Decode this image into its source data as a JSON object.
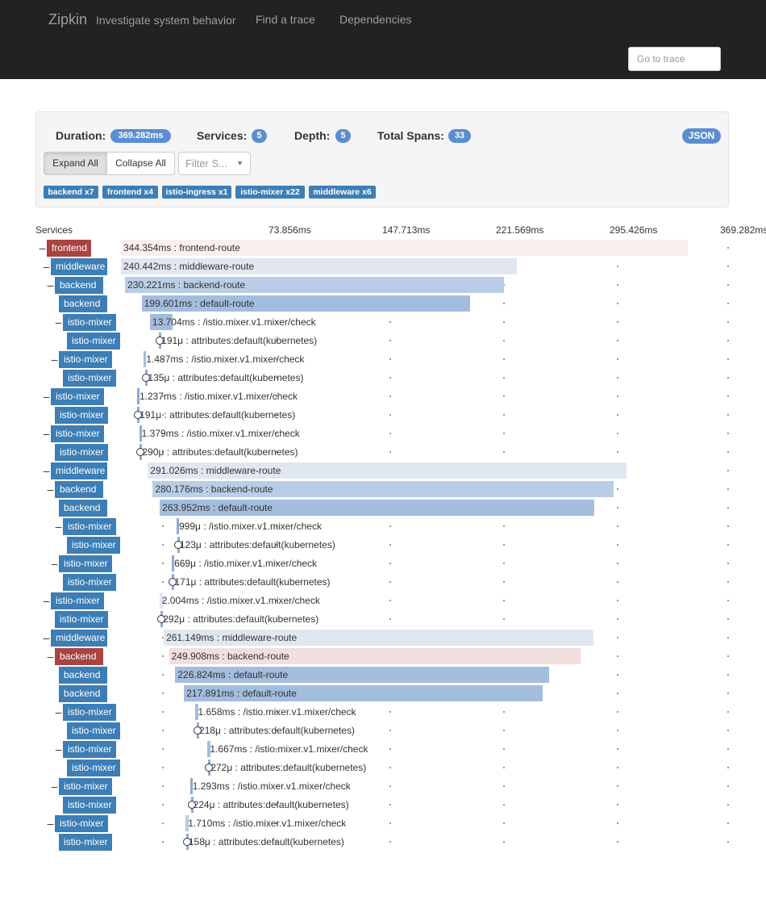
{
  "header": {
    "brand": "Zipkin",
    "tagline": "Investigate system behavior",
    "nav": [
      "Find a trace",
      "Dependencies"
    ],
    "goto_placeholder": "Go to trace"
  },
  "summary": {
    "duration_label": "Duration:",
    "duration": "369.282ms",
    "services_label": "Services:",
    "services": "5",
    "depth_label": "Depth:",
    "depth": "5",
    "spans_label": "Total Spans:",
    "spans": "33",
    "json_label": "JSON"
  },
  "controls": {
    "expand_all": "Expand All",
    "collapse_all": "Collapse All",
    "filter_placeholder": "Filter S..."
  },
  "service_badges": [
    "backend x7",
    "frontend x4",
    "istio-ingress x1",
    "istio-mixer x22",
    "middleware x6"
  ],
  "timeline": {
    "services_header": "Services",
    "ticks": [
      "73.856ms",
      "147.713ms",
      "221.569ms",
      "295.426ms",
      "369.282ms"
    ]
  },
  "colors": {
    "topbar": "#222222",
    "service_label": "#3c7eb5",
    "service_label_error": "#a94442",
    "span_error_bg": "#f2dede",
    "badge": "#5b8ed0"
  },
  "spans": [
    {
      "depth": 0,
      "toggle": "-",
      "service": "frontend",
      "error": true,
      "start_ms": 0,
      "duration_ms": 344.354,
      "label": "344.354ms : frontend-route"
    },
    {
      "depth": 1,
      "toggle": "-",
      "service": "middleware",
      "start_ms": 0,
      "duration_ms": 240.442,
      "label": "240.442ms : middleware-route"
    },
    {
      "depth": 2,
      "toggle": "-",
      "service": "backend",
      "start_ms": 2.5,
      "duration_ms": 230.221,
      "label": "230.221ms : backend-route"
    },
    {
      "depth": 3,
      "toggle": "",
      "service": "backend",
      "start_ms": 12.6,
      "duration_ms": 199.601,
      "label": "199.601ms : default-route"
    },
    {
      "depth": 4,
      "toggle": "-",
      "service": "istio-mixer",
      "start_ms": 17.6,
      "duration_ms": 13.704,
      "label": "13.704ms : /istio.mixer.v1.mixer/check"
    },
    {
      "depth": 5,
      "toggle": "",
      "service": "istio-mixer",
      "start_ms": 23.1,
      "duration_ms": 0.191,
      "label": "191μ : attributes:default(kubernetes)"
    },
    {
      "depth": 3,
      "toggle": "-",
      "service": "istio-mixer",
      "start_ms": 13.9,
      "duration_ms": 1.487,
      "label": "1.487ms : /istio.mixer.v1.mixer/check"
    },
    {
      "depth": 4,
      "toggle": "",
      "service": "istio-mixer",
      "start_ms": 14.9,
      "duration_ms": 0.135,
      "label": "135μ : attributes:default(kubernetes)"
    },
    {
      "depth": 1,
      "toggle": "-",
      "service": "istio-mixer",
      "start_ms": 9.8,
      "duration_ms": 1.237,
      "label": "1.237ms : /istio.mixer.v1.mixer/check"
    },
    {
      "depth": 2,
      "toggle": "",
      "service": "istio-mixer",
      "start_ms": 9.9,
      "duration_ms": 0.191,
      "label": "191μ : attributes:default(kubernetes)"
    },
    {
      "depth": 1,
      "toggle": "-",
      "service": "istio-mixer",
      "start_ms": 11.1,
      "duration_ms": 1.379,
      "label": "1.379ms : /istio.mixer.v1.mixer/check"
    },
    {
      "depth": 2,
      "toggle": "",
      "service": "istio-mixer",
      "start_ms": 11.5,
      "duration_ms": 0.29,
      "label": "290μ : attributes:default(kubernetes)"
    },
    {
      "depth": 1,
      "toggle": "-",
      "service": "middleware",
      "start_ms": 16.3,
      "duration_ms": 291.026,
      "label": "291.026ms : middleware-route"
    },
    {
      "depth": 2,
      "toggle": "-",
      "service": "backend",
      "start_ms": 19.3,
      "duration_ms": 280.176,
      "label": "280.176ms : backend-route"
    },
    {
      "depth": 3,
      "toggle": "",
      "service": "backend",
      "start_ms": 23.6,
      "duration_ms": 263.952,
      "label": "263.952ms : default-route"
    },
    {
      "depth": 4,
      "toggle": "-",
      "service": "istio-mixer",
      "start_ms": 33.8,
      "duration_ms": 0.999,
      "label": "999μ : /istio.mixer.v1.mixer/check"
    },
    {
      "depth": 5,
      "toggle": "",
      "service": "istio-mixer",
      "start_ms": 34.2,
      "duration_ms": 0.123,
      "label": "123μ : attributes:default(kubernetes)"
    },
    {
      "depth": 3,
      "toggle": "-",
      "service": "istio-mixer",
      "start_ms": 30.9,
      "duration_ms": 0.669,
      "label": "669μ : /istio.mixer.v1.mixer/check"
    },
    {
      "depth": 4,
      "toggle": "",
      "service": "istio-mixer",
      "start_ms": 31.1,
      "duration_ms": 0.171,
      "label": "171μ : attributes:default(kubernetes)"
    },
    {
      "depth": 1,
      "toggle": "-",
      "service": "istio-mixer",
      "start_ms": 23.4,
      "duration_ms": 2.004,
      "label": "2.004ms : /istio.mixer.v1.mixer/check"
    },
    {
      "depth": 2,
      "toggle": "",
      "service": "istio-mixer",
      "start_ms": 24.1,
      "duration_ms": 0.292,
      "label": "292μ : attributes:default(kubernetes)"
    },
    {
      "depth": 1,
      "toggle": "-",
      "service": "middleware",
      "start_ms": 26.0,
      "duration_ms": 261.149,
      "label": "261.149ms : middleware-route"
    },
    {
      "depth": 2,
      "toggle": "-",
      "service": "backend",
      "error": true,
      "start_ms": 29.2,
      "duration_ms": 249.908,
      "label": "249.908ms : backend-route"
    },
    {
      "depth": 3,
      "toggle": "",
      "service": "backend",
      "start_ms": 33.0,
      "duration_ms": 226.824,
      "label": "226.824ms : default-route"
    },
    {
      "depth": 3,
      "toggle": "",
      "service": "backend",
      "start_ms": 38.3,
      "duration_ms": 217.891,
      "label": "217.891ms : default-route"
    },
    {
      "depth": 4,
      "toggle": "-",
      "service": "istio-mixer",
      "start_ms": 45.3,
      "duration_ms": 1.658,
      "label": "1.658ms : /istio.mixer.v1.mixer/check"
    },
    {
      "depth": 5,
      "toggle": "",
      "service": "istio-mixer",
      "start_ms": 46.0,
      "duration_ms": 0.218,
      "label": "218μ : attributes:default(kubernetes)"
    },
    {
      "depth": 4,
      "toggle": "-",
      "service": "istio-mixer",
      "start_ms": 52.6,
      "duration_ms": 1.667,
      "label": "1.667ms : /istio.mixer.v1.mixer/check"
    },
    {
      "depth": 5,
      "toggle": "",
      "service": "istio-mixer",
      "start_ms": 53.0,
      "duration_ms": 0.272,
      "label": "272μ : attributes:default(kubernetes)"
    },
    {
      "depth": 3,
      "toggle": "-",
      "service": "istio-mixer",
      "start_ms": 42.0,
      "duration_ms": 1.293,
      "label": "1.293ms : /istio.mixer.v1.mixer/check"
    },
    {
      "depth": 4,
      "toggle": "",
      "service": "istio-mixer",
      "start_ms": 42.4,
      "duration_ms": 0.224,
      "label": "224μ : attributes:default(kubernetes)"
    },
    {
      "depth": 2,
      "toggle": "-",
      "service": "istio-mixer",
      "start_ms": 39.3,
      "duration_ms": 1.71,
      "label": "1.710ms : /istio.mixer.v1.mixer/check"
    },
    {
      "depth": 3,
      "toggle": "",
      "service": "istio-mixer",
      "start_ms": 39.6,
      "duration_ms": 0.158,
      "label": "158μ : attributes:default(kubernetes)"
    }
  ]
}
